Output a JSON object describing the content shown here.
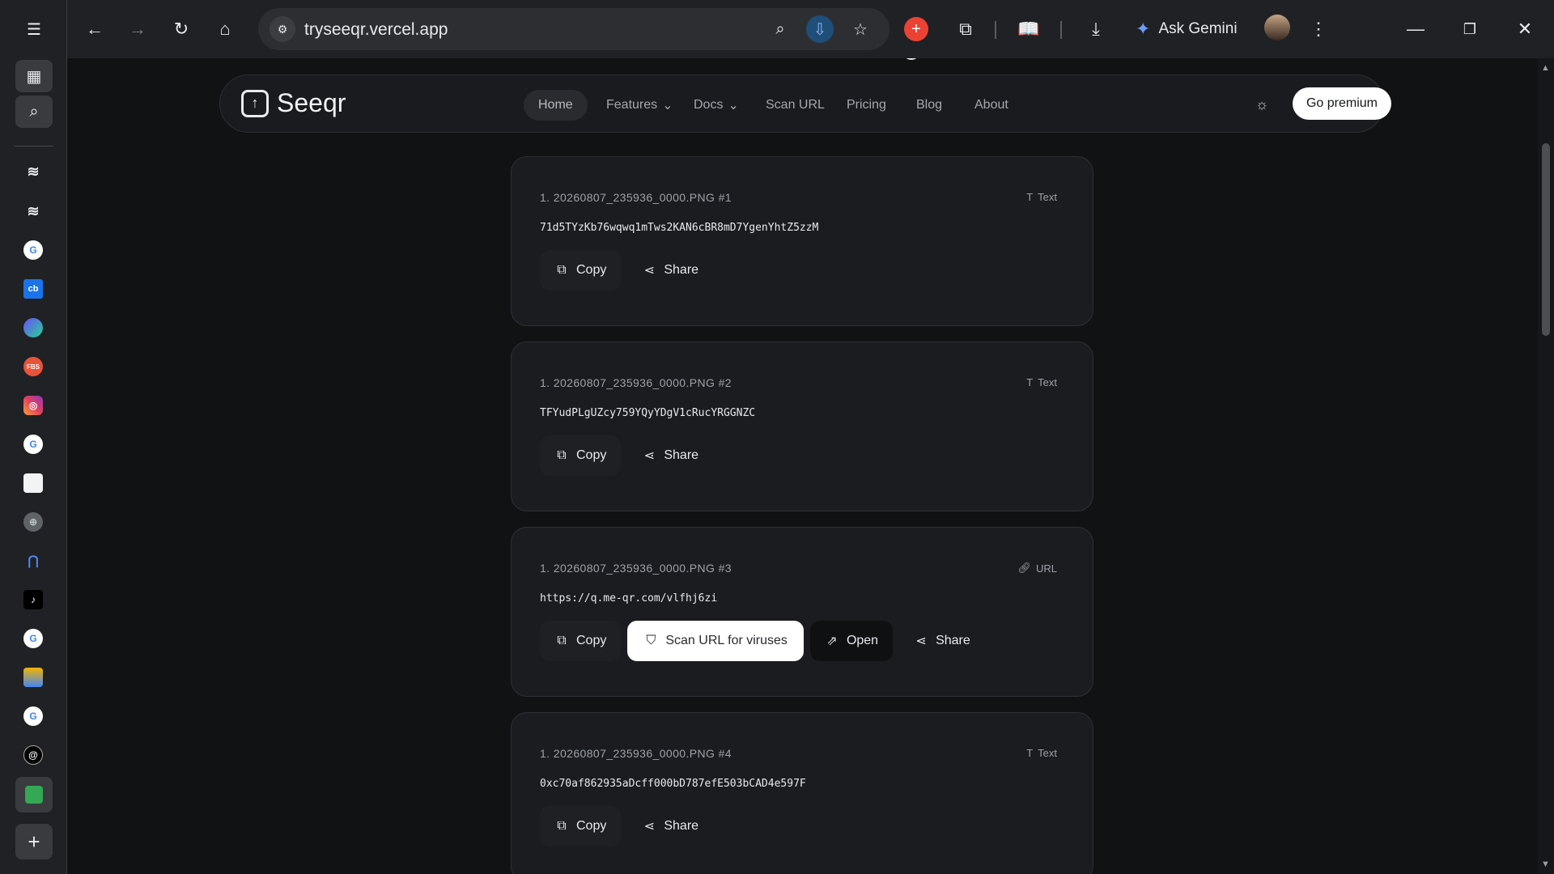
{
  "browser": {
    "url": "tryseeqr.vercel.app",
    "ask_gemini_label": "Ask Gemini"
  },
  "sidebar": {
    "icons": [
      "tab-search-menu-icon",
      "tab-grid-icon",
      "tab-search-icon",
      "layers-icon",
      "layers-icon",
      "google-icon",
      "cb-icon",
      "flow-icon",
      "fbs-icon",
      "instagram-icon",
      "google-icon",
      "notes-icon",
      "globe-icon",
      "arch-icon",
      "tiktok-icon",
      "google-icon",
      "cards-icon",
      "google-icon",
      "threads-icon",
      "seeqr-tab-icon",
      "add-tab-icon"
    ],
    "cb_label": "cb",
    "fbs_label": "FBS"
  },
  "site": {
    "brand": "Seeqr",
    "nav": [
      {
        "label": "Home",
        "active": true
      },
      {
        "label": "Features",
        "dropdown": true
      },
      {
        "label": "Docs",
        "dropdown": true
      },
      {
        "label": "Scan URL"
      },
      {
        "label": "Pricing"
      },
      {
        "label": "Blog"
      },
      {
        "label": "About"
      }
    ],
    "premium_label": "Go premium"
  },
  "results": [
    {
      "title": "1. 20260807_235936_0000.PNG #1",
      "type": "Text",
      "content": "71d5TYzKb76wqwq1mTws2KAN6cBR8mD7YgenYhtZ5zzM",
      "actions": [
        "Copy",
        "Share"
      ]
    },
    {
      "title": "1. 20260807_235936_0000.PNG #2",
      "type": "Text",
      "content": "TFYudPLgUZcy759YQyYDgV1cRucYRGGNZC",
      "actions": [
        "Copy",
        "Share"
      ]
    },
    {
      "title": "1. 20260807_235936_0000.PNG #3",
      "type": "URL",
      "content": "https://q.me-qr.com/vlfhj6zi",
      "actions": [
        "Copy",
        "Scan URL for viruses",
        "Open",
        "Share"
      ]
    },
    {
      "title": "1. 20260807_235936_0000.PNG #4",
      "type": "Text",
      "content": "0xc70af862935aDcff000bD787efE503bCAD4e597F",
      "actions": [
        "Copy",
        "Share"
      ]
    }
  ]
}
